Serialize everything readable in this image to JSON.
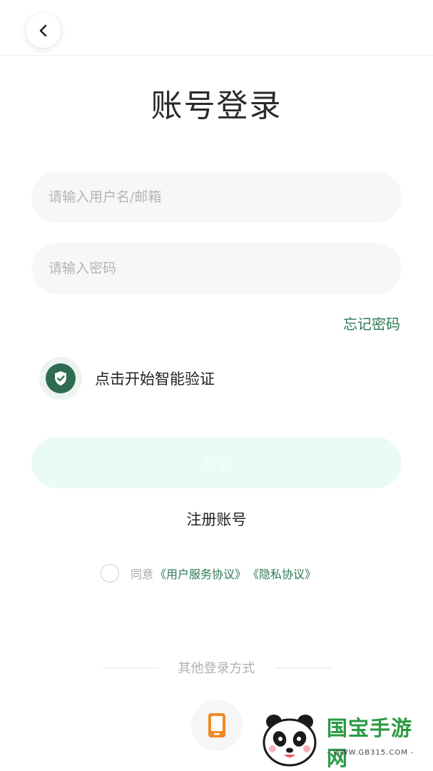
{
  "header": {
    "back_icon": "chevron-left-icon"
  },
  "title": "账号登录",
  "form": {
    "username_placeholder": "请输入用户名/邮箱",
    "password_placeholder": "请输入密码",
    "forgot_label": "忘记密码"
  },
  "verify": {
    "icon": "shield-check-icon",
    "label": "点击开始智能验证"
  },
  "login_label": "登录",
  "register_label": "注册账号",
  "agreement": {
    "prefix": "同意",
    "user_terms": "《用户服务协议》",
    "privacy": "《隐私协议》"
  },
  "other_login": {
    "label": "其他登录方式",
    "phone_icon": "mobile-phone-icon"
  },
  "watermark": {
    "text": "国宝手游网",
    "url": "- WWW.GB315.COM -"
  },
  "colors": {
    "accent": "#2e7856",
    "login_bg": "#eafaf4",
    "phone_icon": "#f08a24",
    "watermark_green": "#2b9a44"
  }
}
